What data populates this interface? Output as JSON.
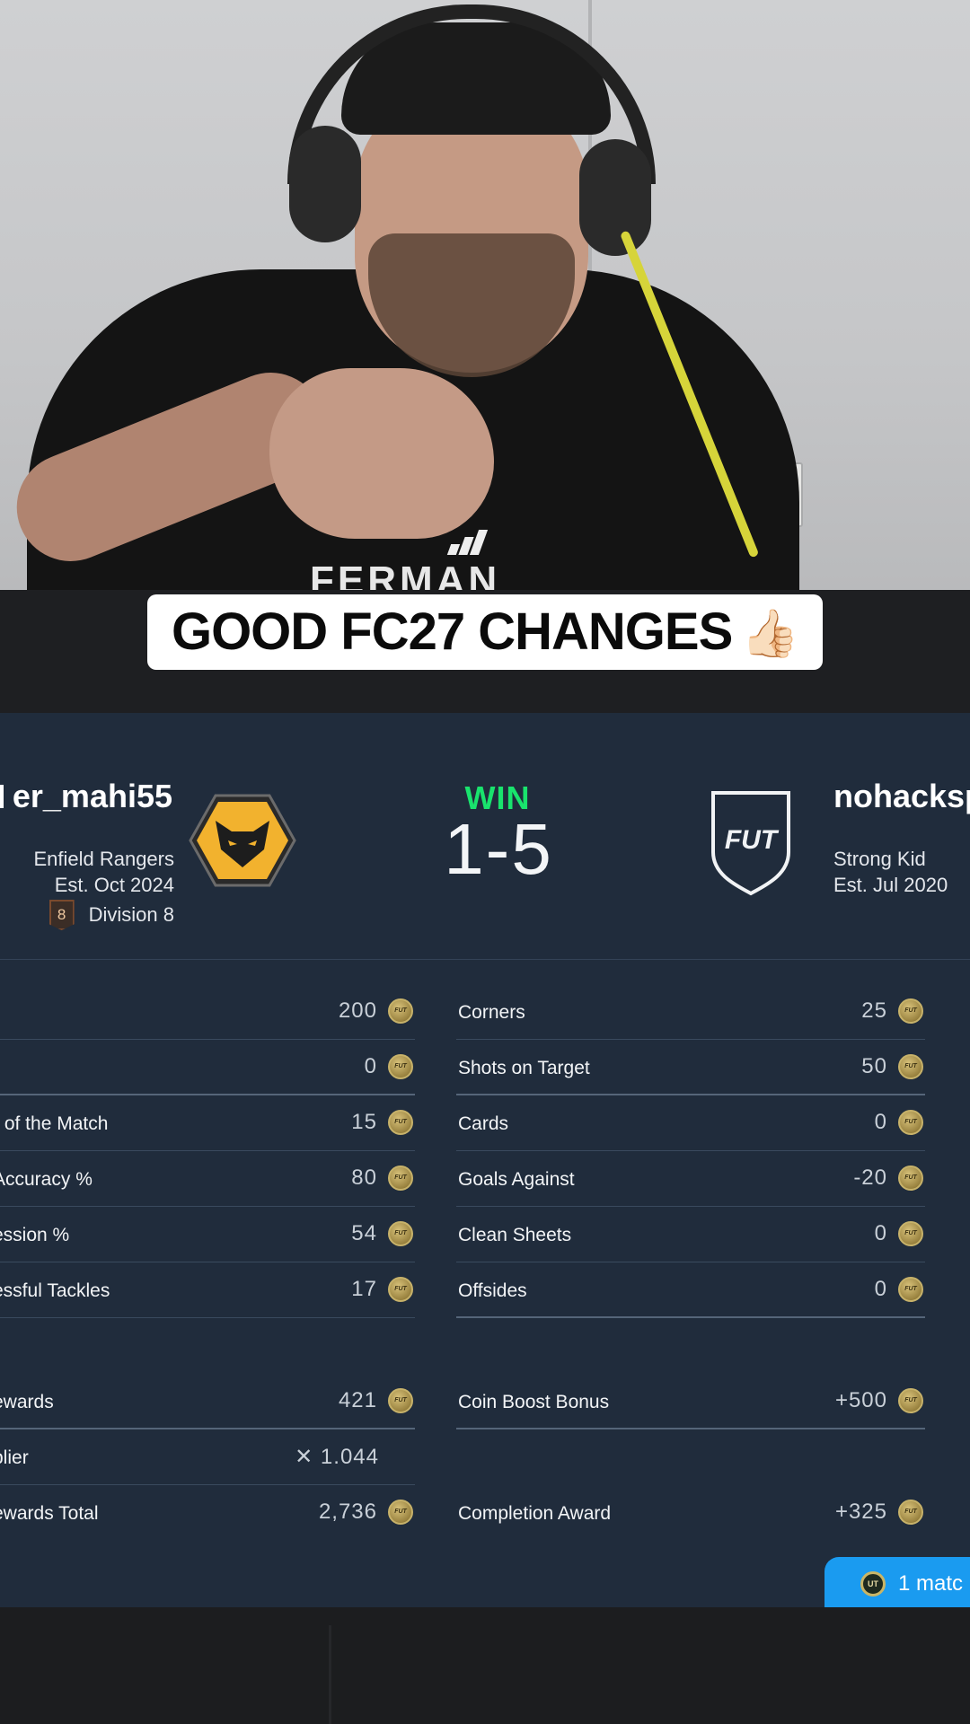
{
  "caption": {
    "text": "GOOD FC27 CHANGES",
    "emoji": "👍🏻"
  },
  "webcam": {
    "shirt_text": "FERMAN"
  },
  "match": {
    "result": "WIN",
    "score": "1-5",
    "home": {
      "name": "er_mahi55",
      "club": "Enfield Rangers",
      "established": "Est. Oct 2024",
      "division_number": "8",
      "division_label": "Division 8"
    },
    "away": {
      "name": "nohacksp",
      "club": "Strong Kid",
      "established": "Est. Jul 2020",
      "badge_text": "FUT"
    }
  },
  "rewards_left": [
    {
      "label": "",
      "value": "200"
    },
    {
      "label": "",
      "value": "0"
    },
    {
      "label": "r of the Match",
      "value": "15"
    },
    {
      "label": "Accuracy %",
      "value": "80"
    },
    {
      "label": "ession %",
      "value": "54"
    },
    {
      "label": "essful Tackles",
      "value": "17"
    }
  ],
  "rewards_right": [
    {
      "label": "Corners",
      "value": "25"
    },
    {
      "label": "Shots on Target",
      "value": "50"
    },
    {
      "label": "Cards",
      "value": "0"
    },
    {
      "label": "Goals Against",
      "value": "-20"
    },
    {
      "label": "Clean Sheets",
      "value": "0"
    },
    {
      "label": "Offsides",
      "value": "0"
    }
  ],
  "totals_left": [
    {
      "label": "ewards",
      "value": "421"
    },
    {
      "label": "plier",
      "value": "✕ 1.044"
    },
    {
      "label": "ewards Total",
      "value": "2,736"
    }
  ],
  "totals_right": [
    {
      "label": "Coin Boost Bonus",
      "value": "+500"
    },
    {
      "label": "Completion Award",
      "value": "+325"
    }
  ],
  "coin_glyph": "FUT",
  "match_pill": {
    "text": "1 matc",
    "icon": "UT"
  },
  "colors": {
    "panel": "#202c3c",
    "win": "#19e36d",
    "pill": "#1a9bf0",
    "caption_bg": "#ffffff"
  }
}
